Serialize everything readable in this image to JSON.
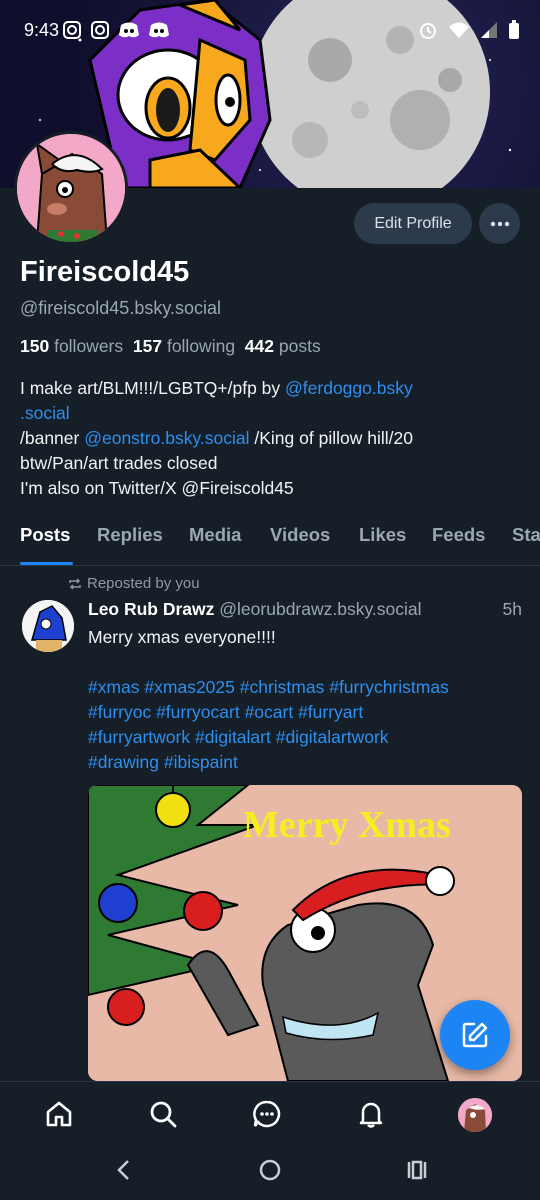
{
  "status_bar": {
    "time": "9:43",
    "left_icons": [
      "instagram-icon",
      "instagram-icon",
      "discord-icon",
      "discord-icon"
    ],
    "right_icons": [
      "alarm-icon",
      "wifi-icon",
      "signal-icon",
      "battery-icon"
    ]
  },
  "profile": {
    "display_name": "Fireiscold45",
    "handle": "@fireiscold45.bsky.social",
    "followers_count": "150",
    "followers_label": "followers",
    "following_count": "157",
    "following_label": "following",
    "posts_count": "442",
    "posts_label": "posts",
    "edit_button": "Edit Profile",
    "bio": {
      "t1": "I make art/BLM!!!/LGBTQ+/pfp by ",
      "link1a": "@ferdoggo.bsky",
      "link1b": ".social",
      "t2": " /banner ",
      "link2": "@eonstro.bsky.social",
      "t3": " /King of pillow hill/20",
      "t4": "btw/Pan/art trades closed",
      "t5": "I'm also on Twitter/X @Fireiscold45"
    }
  },
  "tabs": [
    "Posts",
    "Replies",
    "Media",
    "Videos",
    "Likes",
    "Feeds",
    "Sta"
  ],
  "active_tab": "Posts",
  "feed": [
    {
      "repost_label": "Reposted by you",
      "author": "Leo Rub Drawz",
      "handle": "@leorubdrawz.bsky.social",
      "time": "5h",
      "text": "Merry xmas everyone!!!!",
      "tag_lines": [
        "#xmas #xmas2025 #christmas #furrychristmas",
        "#furryoc #furryocart #ocart #furryart",
        "#furryartwork #digitalart #digitalartwork",
        "#drawing #ibispaint"
      ],
      "image_text": "Merry Xmas"
    }
  ],
  "bottom_nav": [
    "home-icon",
    "search-icon",
    "chat-icon",
    "notifications-icon",
    "profile-avatar"
  ],
  "colors": {
    "background": "#161e27",
    "accent": "#1d84f3",
    "link": "#2d8ff0",
    "muted": "#9aa6b4",
    "button": "#2c3a4b"
  }
}
